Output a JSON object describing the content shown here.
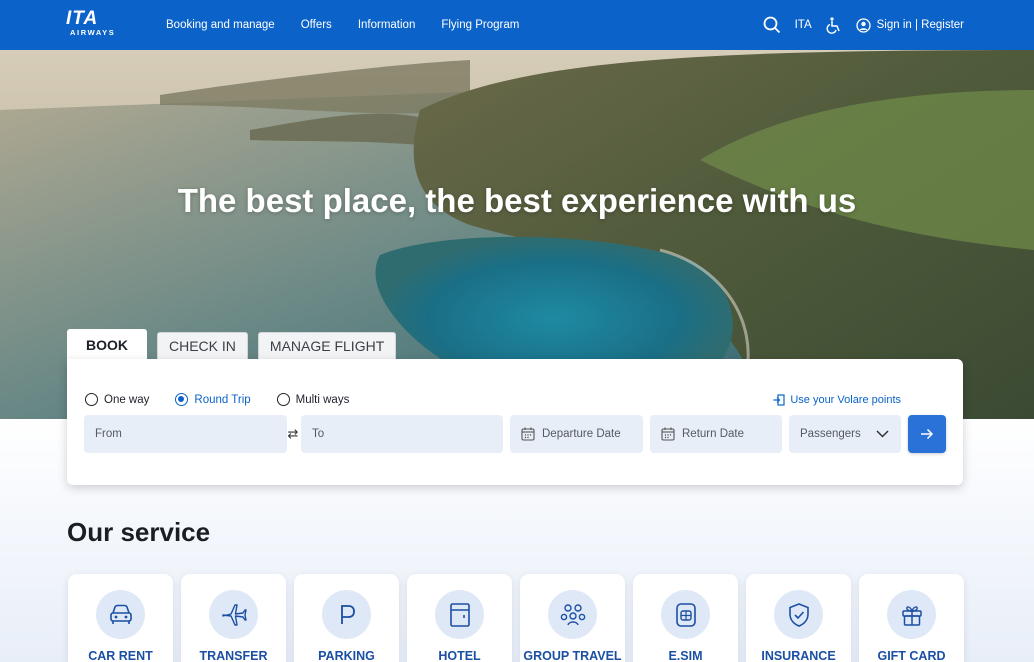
{
  "header": {
    "logo_text": "ITA",
    "logo_sub": "AIRWAYS",
    "nav": [
      "Booking and manage",
      "Offers",
      "Information",
      "Flying Program"
    ],
    "language": "ITA",
    "signin_label": "Sign in | Register",
    "icons": {
      "search": "search-icon",
      "accessibility": "wheelchair-icon",
      "user": "user-icon"
    }
  },
  "hero": {
    "title": "The best place, the best experience with us"
  },
  "booking": {
    "tabs": [
      "BOOK",
      "CHECK IN",
      "MANAGE FLIGHT"
    ],
    "active_tab": "BOOK",
    "trip_types": [
      "One way",
      "Round Trip",
      "Multi ways"
    ],
    "selected_trip": "Round Trip",
    "volare_link": "Use your Volare points",
    "from_placeholder": "From",
    "to_placeholder": "To",
    "departure_placeholder": "Departure Date",
    "return_placeholder": "Return Date",
    "passengers_placeholder": "Passengers"
  },
  "services": {
    "title": "Our service",
    "items": [
      {
        "label": "CAR RENT",
        "icon": "car-icon"
      },
      {
        "label": "TRANSFER",
        "icon": "plane-icon"
      },
      {
        "label": "PARKING",
        "icon": "parking-icon"
      },
      {
        "label": "HOTEL",
        "icon": "hotel-icon"
      },
      {
        "label": "GROUP TRAVEL",
        "icon": "group-icon"
      },
      {
        "label": "E.SIM",
        "icon": "sim-icon"
      },
      {
        "label": "INSURANCE",
        "icon": "shield-icon"
      },
      {
        "label": "GIFT CARD",
        "icon": "gift-icon"
      }
    ]
  },
  "colors": {
    "brand": "#0b63c9",
    "button": "#2a72d8",
    "field_bg": "#e8eef7"
  }
}
